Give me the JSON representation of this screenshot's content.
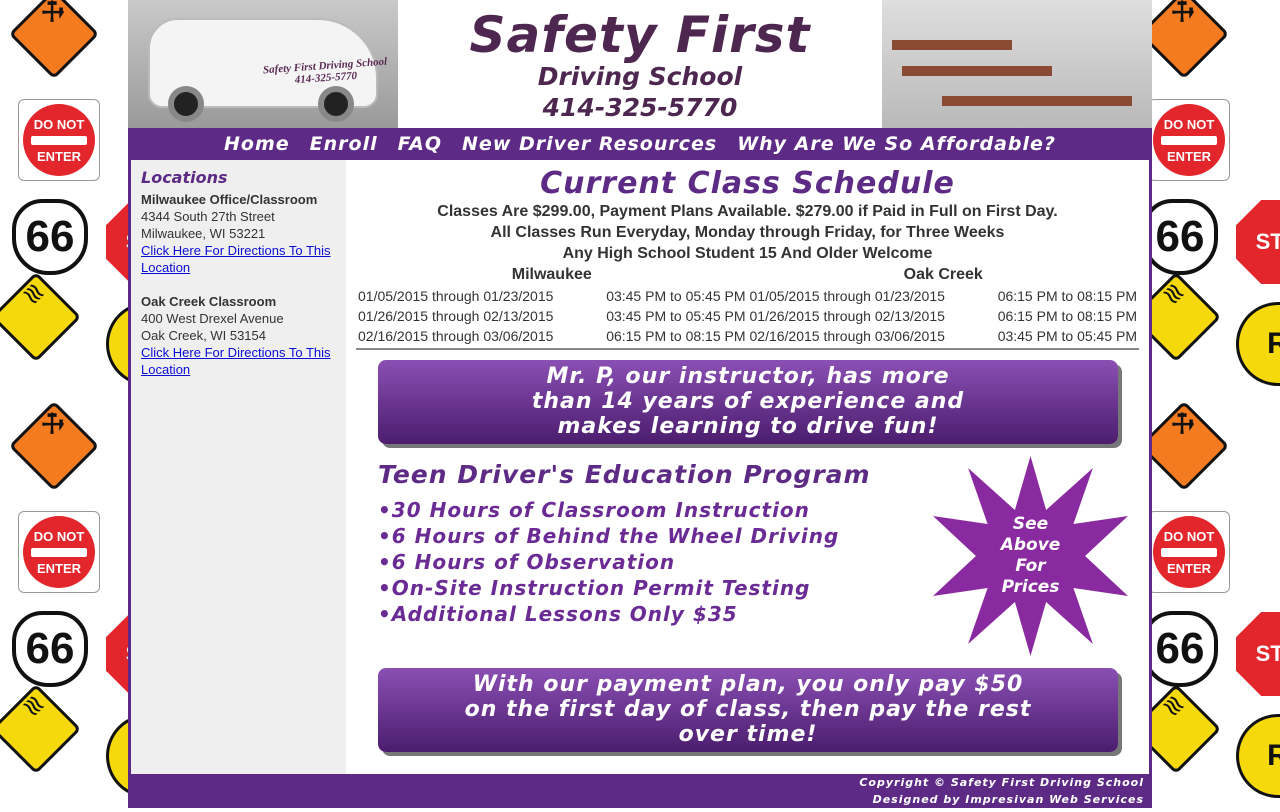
{
  "header": {
    "school_name": "Safety First",
    "school_subtitle": "Driving School",
    "phone": "414-325-5770",
    "car_decal": "Safety First Driving School 414-325-5770"
  },
  "nav": {
    "items": [
      "Home",
      "Enroll",
      "FAQ",
      "New Driver Resources",
      "Why Are We So Affordable?"
    ]
  },
  "sidebar": {
    "heading": "Locations",
    "locations": [
      {
        "name": "Milwaukee Office/Classroom",
        "street": "4344 South 27th Street",
        "city": "Milwaukee, WI 53221",
        "link": "Click Here For Directions To This Location"
      },
      {
        "name": "Oak Creek Classroom",
        "street": "400 West Drexel Avenue",
        "city": "Oak Creek, WI 53154",
        "link": "Click Here For Directions To This Location"
      }
    ]
  },
  "schedule": {
    "title": "Current Class Schedule",
    "lines": [
      "Classes Are $299.00, Payment Plans Available. $279.00 if Paid in Full on First Day.",
      "All Classes Run Everyday, Monday through Friday, for Three Weeks",
      "Any High School Student 15 And Older Welcome"
    ],
    "columns": [
      {
        "heading": "Milwaukee",
        "rows": [
          {
            "dates": "01/05/2015 through 01/23/2015",
            "time": "03:45 PM to 05:45 PM"
          },
          {
            "dates": "01/26/2015 through 02/13/2015",
            "time": "03:45 PM to 05:45 PM"
          },
          {
            "dates": "02/16/2015 through 03/06/2015",
            "time": "06:15 PM to 08:15 PM"
          }
        ]
      },
      {
        "heading": "Oak Creek",
        "rows": [
          {
            "dates": "01/05/2015 through 01/23/2015",
            "time": "06:15 PM to 08:15 PM"
          },
          {
            "dates": "01/26/2015 through 02/13/2015",
            "time": "06:15 PM to 08:15 PM"
          },
          {
            "dates": "02/16/2015 through 03/06/2015",
            "time": "03:45 PM to 05:45 PM"
          }
        ]
      }
    ]
  },
  "banner_instructor": {
    "lines": [
      "Mr. P, our instructor, has more",
      "than 14 years of experience and",
      "makes learning to drive fun!"
    ]
  },
  "program": {
    "title": "Teen Driver's Education Program",
    "items": [
      "•30 Hours of Classroom Instruction",
      "•6 Hours of Behind the Wheel Driving",
      "•6 Hours of Observation",
      "•On-Site Instruction Permit Testing",
      "•Additional Lessons Only $35"
    ],
    "burst_lines": [
      "See",
      "Above",
      "For",
      "Prices"
    ]
  },
  "banner_payment": {
    "lines": [
      "With our payment plan, you only pay $50",
      "on the first day of class, then pay the rest",
      "over time!"
    ]
  },
  "footer": {
    "copyright": "Copyright © Safety First Driving School",
    "designed_by": "Designed by Impresivan Web Services"
  },
  "signs": {
    "do_not": "DO NOT",
    "enter": "ENTER",
    "route": "66",
    "stop": "STO",
    "railroad": "R"
  },
  "colors": {
    "brand_purple": "#5d2b85",
    "title_purple": "#4e2750",
    "link_blue": "#0b0bd8"
  }
}
